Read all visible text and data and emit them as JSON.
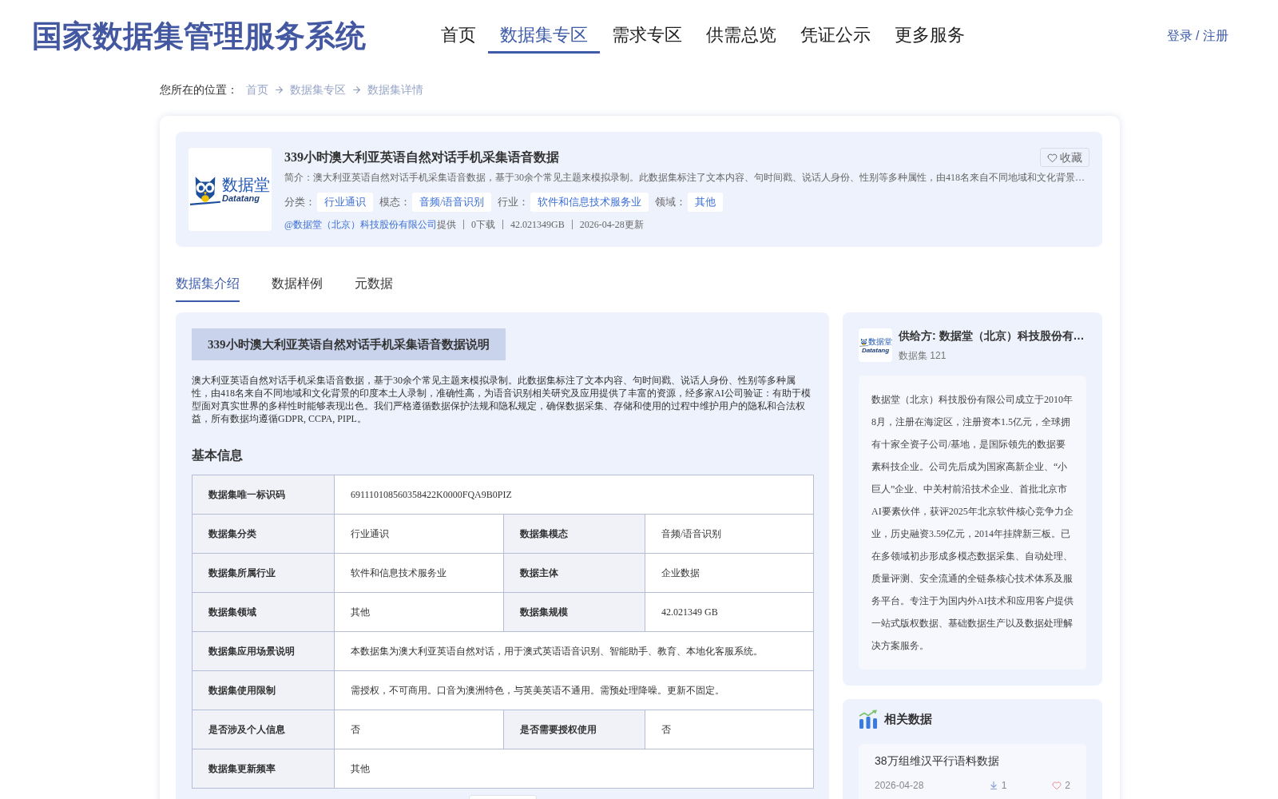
{
  "header": {
    "title": "国家数据集管理服务系统",
    "nav": [
      {
        "label": "首页",
        "selected": false
      },
      {
        "label": "数据集专区",
        "selected": true
      },
      {
        "label": "需求专区",
        "selected": false
      },
      {
        "label": "供需总览",
        "selected": false
      },
      {
        "label": "凭证公示",
        "selected": false
      },
      {
        "label": "更多服务",
        "selected": false
      }
    ],
    "auth": "登录 / 注册"
  },
  "breadcrumb": {
    "prefix": "您所在的位置：",
    "items": [
      "首页",
      "数据集专区",
      "数据集详情"
    ]
  },
  "dataset": {
    "logo": {
      "name": "数据堂",
      "latin": "Datatang"
    },
    "title": "339小时澳大利亚英语自然对话手机采集语音数据",
    "favorite": "收藏",
    "summary": "简介：澳大利亚英语自然对话手机采集语音数据，基于30余个常见主题来模拟录制。此数据集标注了文本内容、句时间戳、说话人身份、性别等多种属性，由418名来自不同地域和文化背景…",
    "tags": [
      {
        "label": "分类：",
        "value": "行业通识"
      },
      {
        "label": "模态：",
        "value": "音频/语音识别"
      },
      {
        "label": "行业：",
        "value": "软件和信息技术服务业"
      },
      {
        "label": "领域：",
        "value": "其他"
      }
    ],
    "provider": "@数据堂（北京）科技股份有限公司",
    "provider_suffix": "提供",
    "stats": [
      "0下载",
      "42.021349GB",
      "2026-04-28更新"
    ]
  },
  "tabs": [
    {
      "label": "数据集介绍",
      "selected": true
    },
    {
      "label": "数据样例",
      "selected": false
    },
    {
      "label": "元数据",
      "selected": false
    }
  ],
  "intro": {
    "heading": "339小时澳大利亚英语自然对话手机采集语音数据说明",
    "paragraph": "澳大利亚英语自然对话手机采集语音数据，基于30余个常见主题来模拟录制。此数据集标注了文本内容、句时间戳、说话人身份、性别等多种属性，由418名来自不同地域和文化背景的印度本土人录制，准确性高，为语音识别相关研究及应用提供了丰富的资源，经多家AI公司验证：有助于模型面对真实世界的多样性时能够表现出色。我们严格遵循数据保护法规和隐私规定，确保数据采集、存储和使用的过程中维护用户的隐私和合法权益，所有数据均遵循GDPR, CCPA, PIPL。",
    "basic_info_title": "基本信息",
    "table": {
      "rows": [
        [
          {
            "label": "数据集唯一标识码",
            "value": "691110108560358422K0000FQA9B0PIZ"
          }
        ],
        [
          {
            "label": "数据集分类",
            "value": "行业通识"
          },
          {
            "label": "数据集模态",
            "value": "音频/语音识别"
          }
        ],
        [
          {
            "label": "数据集所属行业",
            "value": "软件和信息技术服务业"
          },
          {
            "label": "数据主体",
            "value": "企业数据"
          }
        ],
        [
          {
            "label": "数据集领域",
            "value": "其他"
          },
          {
            "label": "数据集规模",
            "value": "42.021349 GB"
          }
        ],
        [
          {
            "label": "数据集应用场景说明",
            "value": "本数据集为澳大利亚英语自然对话，用于澳式英语语音识别、智能助手、教育、本地化客服系统。"
          }
        ],
        [
          {
            "label": "数据集使用限制",
            "value": "需授权，不可商用。口音为澳洲特色，与英美英语不通用。需预处理降噪。更新不固定。"
          }
        ],
        [
          {
            "label": "是否涉及个人信息",
            "value": "否"
          },
          {
            "label": "是否需要授权使用",
            "value": "否"
          }
        ],
        [
          {
            "label": "数据集更新频率",
            "value": "其他"
          }
        ]
      ]
    }
  },
  "supplier": {
    "logo": {
      "name": "数据堂",
      "latin": "Datatang"
    },
    "name": "供给方: 数据堂（北京）科技股份有…",
    "count": "数据集 121",
    "description": "数据堂（北京）科技股份有限公司成立于2010年8月，注册在海淀区，注册资本1.5亿元，全球拥有十家全资子公司/基地，是国际领先的数据要素科技企业。公司先后成为国家高新企业、“小巨人”企业、中关村前沿技术企业、首批北京市AI要素伙伴，获评2025年北京软件核心竞争力企业，历史融资3.59亿元，2014年挂牌新三板。已在多领域初步形成多模态数据采集、自动处理、质量评测、安全流通的全链条核心技术体系及服务平台。专注于为国内外AI技术和应用客户提供一站式版权数据、基础数据生产以及数据处理解决方案服务。"
  },
  "related": {
    "title": "相关数据",
    "items": [
      {
        "title": "38万组维汉平行语料数据",
        "date": "2026-04-28",
        "downloads": "1",
        "likes": "2"
      }
    ]
  }
}
